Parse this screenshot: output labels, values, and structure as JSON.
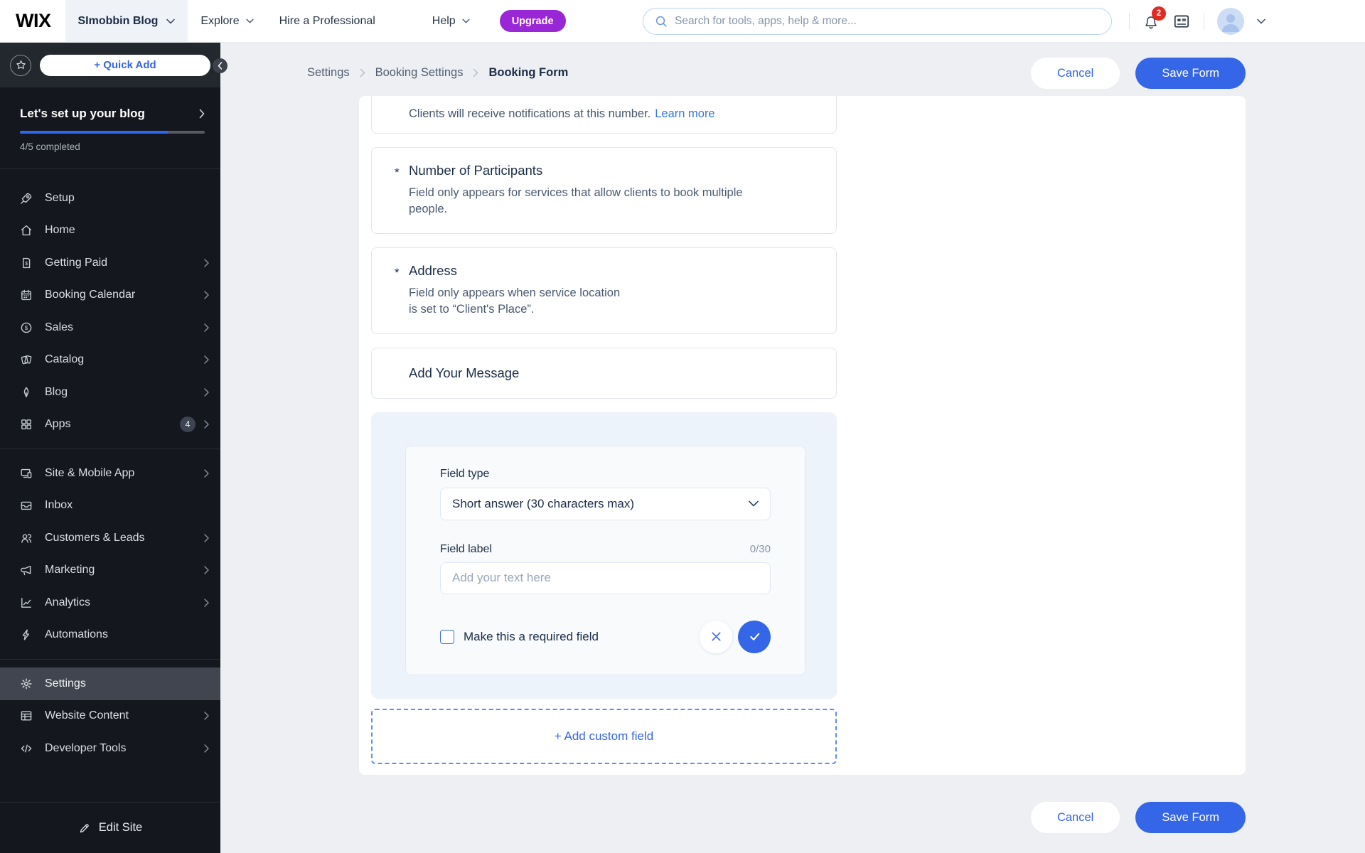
{
  "topbar": {
    "logo": "WIX",
    "site_name": "SImobbin Blog",
    "nav_explore": "Explore",
    "nav_hire": "Hire a Professional",
    "nav_help": "Help",
    "upgrade_label": "Upgrade",
    "search_placeholder": "Search for tools, apps, help & more...",
    "notification_count": "2"
  },
  "sidebar": {
    "quick_add_label": "+ Quick Add",
    "setup_banner": {
      "title": "Let's set up your blog",
      "progress_percent": 80,
      "progress_label": "4/5 completed"
    },
    "menu": [
      {
        "label": "Setup",
        "icon": "rocket-icon"
      },
      {
        "label": "Home",
        "icon": "home-icon"
      },
      {
        "label": "Getting Paid",
        "icon": "getting-paid-icon"
      },
      {
        "label": "Booking Calendar",
        "icon": "calendar-icon"
      },
      {
        "label": "Sales",
        "icon": "sales-icon"
      },
      {
        "label": "Catalog",
        "icon": "catalog-icon"
      },
      {
        "label": "Blog",
        "icon": "blog-icon"
      },
      {
        "label": "Apps",
        "icon": "apps-icon",
        "badge": "4"
      },
      {
        "label": "Site & Mobile App",
        "icon": "devices-icon"
      },
      {
        "label": "Inbox",
        "icon": "inbox-icon"
      },
      {
        "label": "Customers & Leads",
        "icon": "customers-icon"
      },
      {
        "label": "Marketing",
        "icon": "megaphone-icon"
      },
      {
        "label": "Analytics",
        "icon": "analytics-icon"
      },
      {
        "label": "Automations",
        "icon": "lightning-icon"
      },
      {
        "label": "Settings",
        "icon": "gear-icon",
        "active": true
      },
      {
        "label": "Website Content",
        "icon": "table-icon"
      },
      {
        "label": "Developer Tools",
        "icon": "code-icon"
      }
    ],
    "edit_site_label": "Edit Site"
  },
  "header": {
    "breadcrumb": [
      "Settings",
      "Booking Settings",
      "Booking Form"
    ],
    "cancel_label": "Cancel",
    "save_label": "Save Form"
  },
  "form": {
    "required_marker": "*",
    "phone_note": {
      "text": "Clients will receive notifications at this number.",
      "link_label": "Learn more"
    },
    "cards": [
      {
        "required": true,
        "title": "Number of Participants",
        "desc_line1": "Field only appears for services that allow clients to book multiple",
        "desc_line2": "people."
      },
      {
        "required": true,
        "title": "Address",
        "desc_line1": "Field only appears when service location",
        "desc_line2": "is set to “Client's Place”."
      },
      {
        "required": false,
        "title": "Add Your Message"
      }
    ],
    "editor": {
      "field_type_label": "Field type",
      "field_type_value": "Short answer (30 characters max)",
      "field_label_label": "Field label",
      "char_counter": "0/30",
      "input_placeholder": "Add your text here",
      "required_checkbox_label": "Make this a required field",
      "checkbox_checked": false
    },
    "add_custom_field_label": "+ Add custom field"
  },
  "footer": {
    "cancel_label": "Cancel",
    "save_label": "Save Form"
  },
  "colors": {
    "accent_blue": "#3566e8",
    "link_blue": "#3579dd",
    "upgrade_purple": "#9a27d5",
    "badge_red": "#e02b20",
    "sidebar_bg": "#14171e",
    "active_item_bg": "#40454f",
    "editor_panel_bg": "#edf3fa",
    "page_bg": "#edeff3"
  }
}
